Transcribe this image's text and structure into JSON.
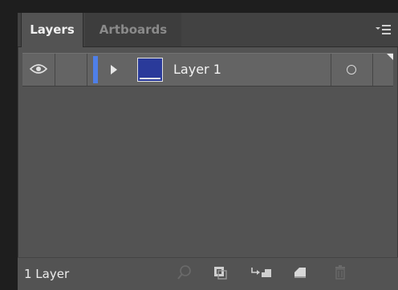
{
  "tabs": [
    {
      "label": "Layers",
      "active": true
    },
    {
      "label": "Artboards",
      "active": false
    }
  ],
  "panel_menu_icon": "panel-menu-icon",
  "layers": [
    {
      "name": "Layer 1",
      "visible": true,
      "color": "#4f7fe8",
      "collapsed": true
    }
  ],
  "footer": {
    "count_label": "1 Layer",
    "buttons": [
      {
        "icon": "locate-object-icon",
        "enabled": false
      },
      {
        "icon": "make-clipping-mask-icon",
        "enabled": true
      },
      {
        "icon": "create-sublayer-icon",
        "enabled": true
      },
      {
        "icon": "create-new-layer-icon",
        "enabled": true
      },
      {
        "icon": "delete-icon",
        "enabled": false
      }
    ]
  },
  "colors": {
    "panel_bg": "#535353",
    "row_bg": "#646464",
    "accent": "#4f7fe8",
    "thumb": "#2a3a9a"
  }
}
